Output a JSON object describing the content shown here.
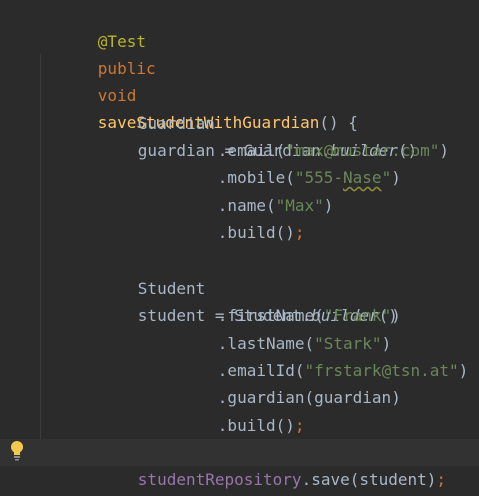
{
  "editor": {
    "colors": {
      "background": "#2b2b2b",
      "current_line": "#323232",
      "default_text": "#a9b7c6",
      "keyword": "#cc7832",
      "annotation": "#bbb529",
      "method_declaration": "#ffc66d",
      "string": "#6a8759",
      "field": "#9876aa",
      "bulb": "#f2c94c"
    },
    "icons": {
      "gutter": "lightbulb-icon"
    },
    "lines": {
      "l1": {
        "annotation": "@Test"
      },
      "l2": {
        "kw_public": "public",
        "kw_void": "void",
        "method_name": "saveStudentWithGuardian",
        "params_open": "() {"
      },
      "l4": {
        "type": "Guardian",
        "var": "guardian",
        "assign": " = ",
        "class_ref": "Guardian",
        "dot": ".",
        "builder": "builder",
        "parens": "()"
      },
      "l5": {
        "call": ".email(",
        "value": "\"max@mustar.com\"",
        "close": ")"
      },
      "l6": {
        "call": ".mobile(",
        "value_open": "\"555-",
        "value_typo": "Nase",
        "value_close": "\"",
        "close": ")"
      },
      "l7": {
        "call": ".name(",
        "value": "\"Max\"",
        "close": ")"
      },
      "l8": {
        "call": ".build()",
        "semicolon": ";"
      },
      "l10": {
        "type": "Student",
        "var": "student",
        "assign": " = ",
        "class_ref": "Student",
        "dot": ".",
        "builder": "builder",
        "parens": "()"
      },
      "l11": {
        "call": ".firstName(",
        "value": "\"Frank\"",
        "close": ")"
      },
      "l12": {
        "call": ".lastName(",
        "value": "\"Stark\"",
        "close": ")"
      },
      "l13": {
        "call": ".emailId(",
        "value": "\"frstark@tsn.at\"",
        "close": ")"
      },
      "l14": {
        "call": ".guardian(guardian)"
      },
      "l15": {
        "call": ".build()",
        "semicolon": ";"
      },
      "l17": {
        "field": "studentRepository",
        "call": ".save(student)",
        "semicolon": ";"
      },
      "l18": {
        "brace": "}"
      }
    }
  }
}
